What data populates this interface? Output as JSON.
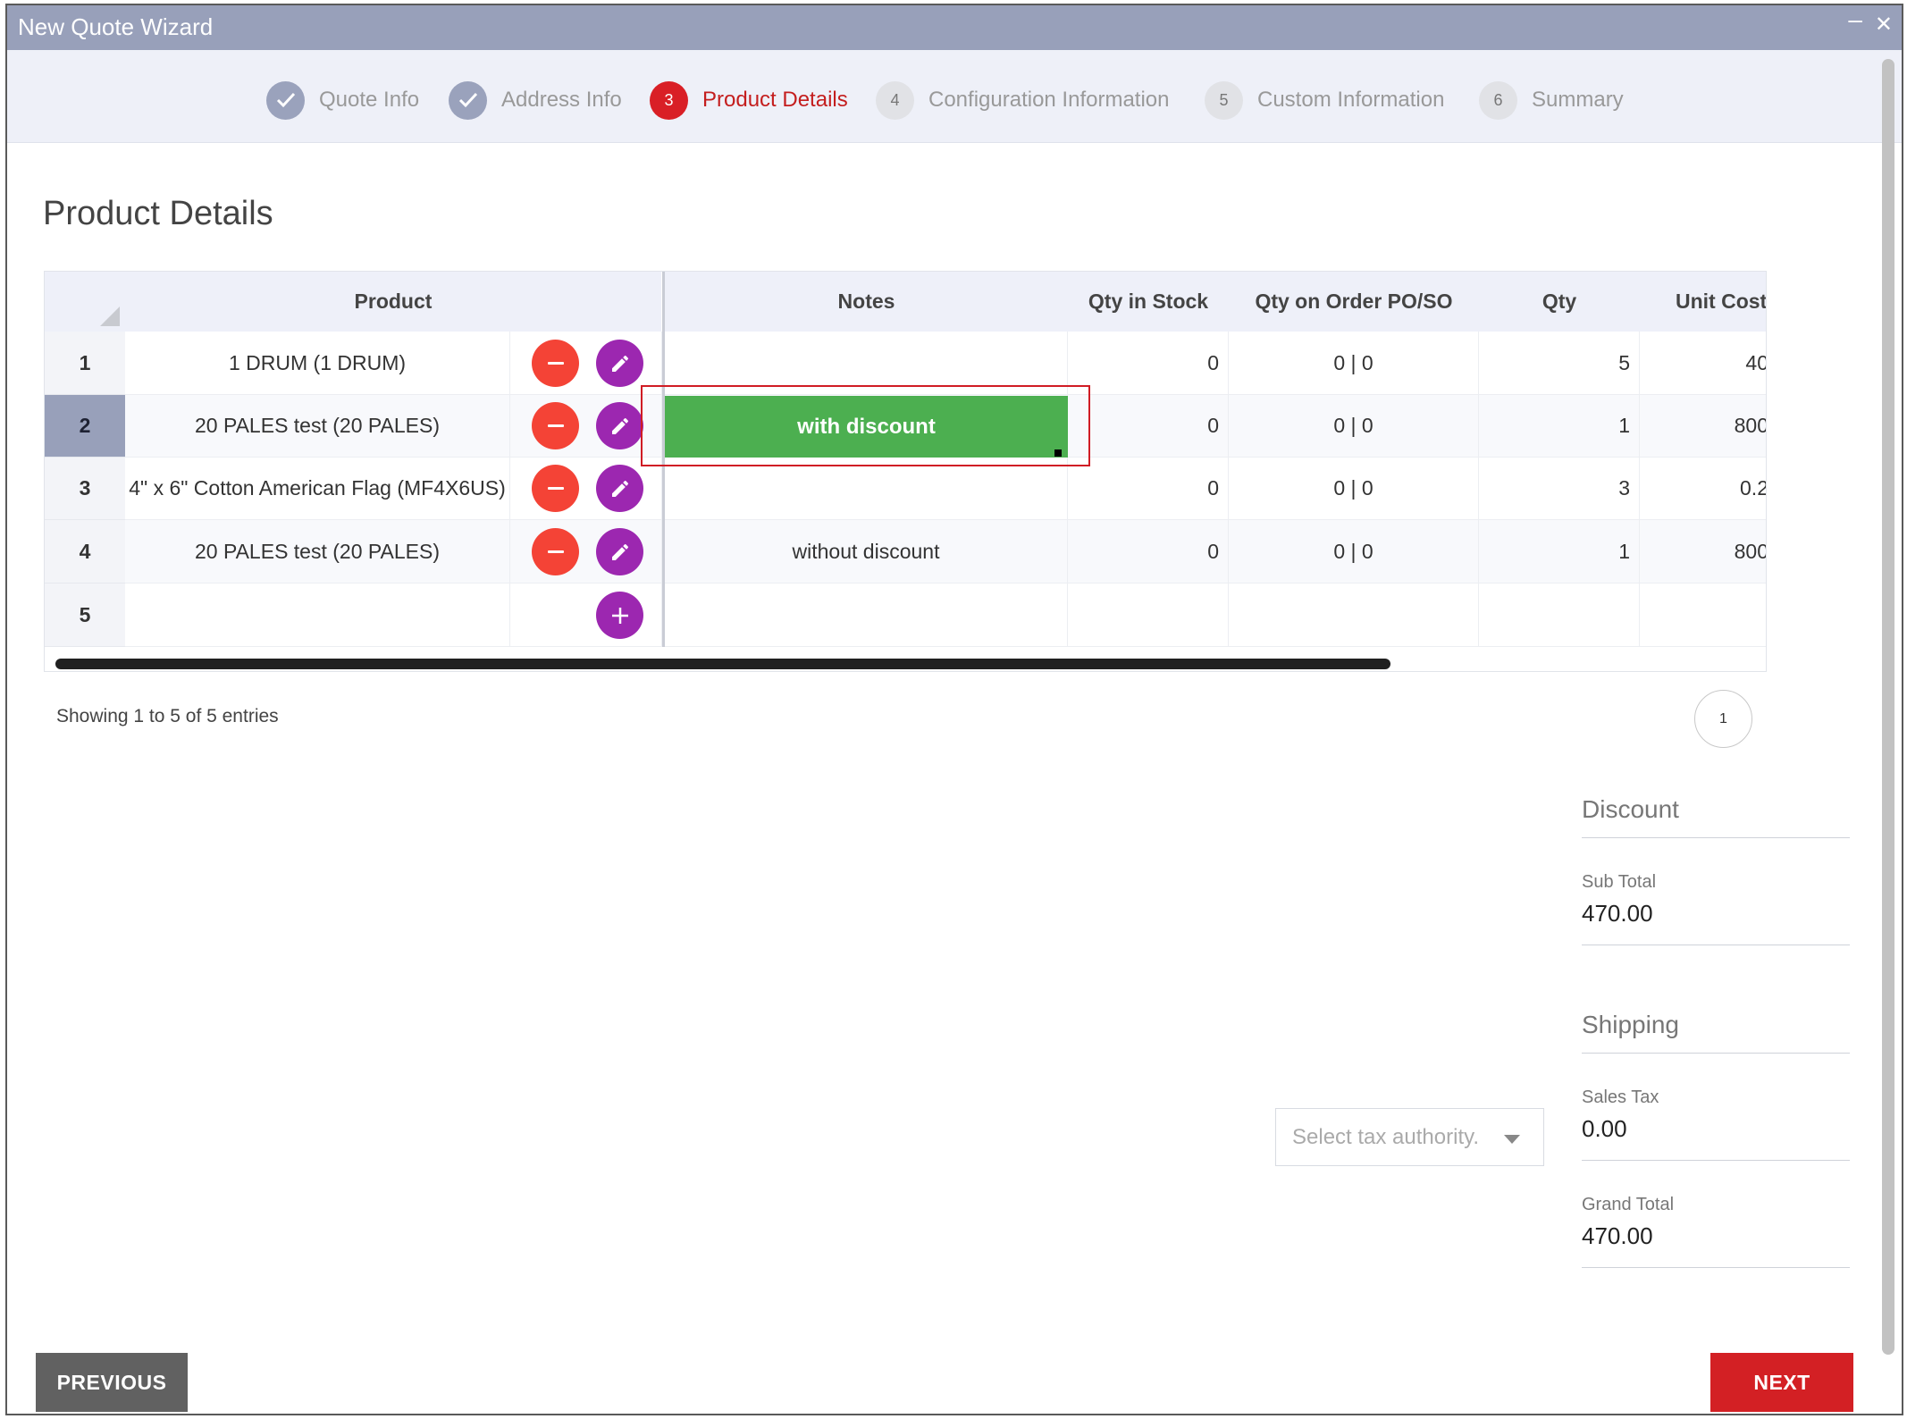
{
  "window": {
    "title": "New Quote Wizard",
    "minimize": "–",
    "close": "✕"
  },
  "steps": [
    {
      "num": "",
      "label": "Quote Info",
      "state": "done"
    },
    {
      "num": "",
      "label": "Address Info",
      "state": "done"
    },
    {
      "num": "3",
      "label": "Product Details",
      "state": "active"
    },
    {
      "num": "4",
      "label": "Configuration Information",
      "state": "todo"
    },
    {
      "num": "5",
      "label": "Custom Information",
      "state": "todo"
    },
    {
      "num": "6",
      "label": "Summary",
      "state": "todo"
    }
  ],
  "page_title": "Product Details",
  "table": {
    "columns": [
      "Product",
      "Notes",
      "Qty in Stock",
      "Qty on Order PO/SO",
      "Qty",
      "Unit Cost"
    ],
    "rows": [
      {
        "num": "1",
        "product": "1 DRUM (1 DRUM)",
        "notes": "",
        "stock": "0",
        "order": "0 | 0",
        "qty": "5",
        "unit": "40"
      },
      {
        "num": "2",
        "product": "20 PALES test (20 PALES)",
        "notes": "with discount",
        "stock": "0",
        "order": "0 | 0",
        "qty": "1",
        "unit": "800"
      },
      {
        "num": "3",
        "product": "4\" x 6\" Cotton American Flag (MF4X6US)",
        "notes": "",
        "stock": "0",
        "order": "0 | 0",
        "qty": "3",
        "unit": "0.2"
      },
      {
        "num": "4",
        "product": "20 PALES test (20 PALES)",
        "notes": "without discount",
        "stock": "0",
        "order": "0 | 0",
        "qty": "1",
        "unit": "800"
      },
      {
        "num": "5",
        "product": "",
        "notes": "",
        "stock": "",
        "order": "",
        "qty": "",
        "unit": ""
      }
    ],
    "selected_row": "2",
    "highlight_color": "#4caf50"
  },
  "entries_text": "Showing 1 to 5 of 5 entries",
  "pagination": {
    "current": "1"
  },
  "summary": {
    "discount_label": "Discount",
    "subtotal_label": "Sub Total",
    "subtotal_value": "470.00",
    "shipping_label": "Shipping",
    "sales_tax_label": "Sales Tax",
    "sales_tax_value": "0.00",
    "grand_total_label": "Grand Total",
    "grand_total_value": "470.00"
  },
  "tax_select": {
    "placeholder": "Select tax authority."
  },
  "buttons": {
    "previous": "PREVIOUS",
    "next": "NEXT"
  },
  "colors": {
    "accent": "#d32024",
    "titlebar": "#98a0ba",
    "purple": "#9c27b0",
    "red": "#f44336"
  }
}
